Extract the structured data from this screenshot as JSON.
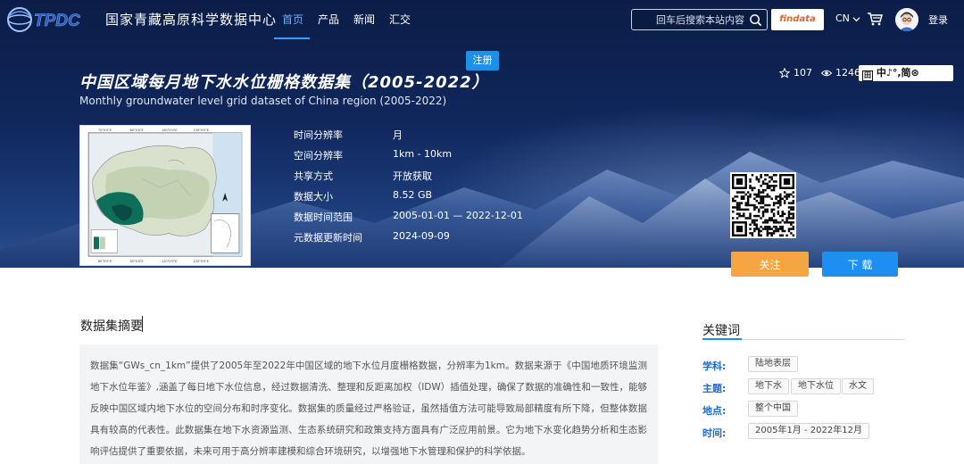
{
  "nav": {
    "site_name": "国家青藏高原科学数据中心",
    "items": [
      {
        "label": "首页",
        "active": true
      },
      {
        "label": "产品",
        "active": false
      },
      {
        "label": "新闻",
        "active": false
      },
      {
        "label": "汇交",
        "active": false
      }
    ],
    "search_placeholder": "回车后搜索本站内容",
    "findata_label": "findata",
    "lang_label": "CN",
    "login_label": "登录"
  },
  "dataset": {
    "register_label": "注册",
    "title_cn": "中国区域每月地下水水位栅格数据集（2005-2022）",
    "title_en": "Monthly groundwater level grid dataset of China region (2005-2022)",
    "stars": "107",
    "views": "1246",
    "toolbar_text": "中♪°,简⊛"
  },
  "meta": [
    {
      "label": "时间分辨率",
      "value": "月"
    },
    {
      "label": "空间分辨率",
      "value": "1km - 10km"
    },
    {
      "label": "共享方式",
      "value": "开放获取"
    },
    {
      "label": "数据大小",
      "value": "8.52 GB"
    },
    {
      "label": "数据时间范围",
      "value": "2005-01-01 — 2022-12-01"
    },
    {
      "label": "元数据更新时间",
      "value": "2024-09-09"
    }
  ],
  "actions": {
    "follow_label": "关注",
    "download_label": "下 载"
  },
  "abstract": {
    "title": "数据集摘要",
    "text": "数据集“GWs_cn_1km”提供了2005年至2022年中国区域的地下水位月度栅格数据，分辨率为1km。数据来源于《中国地质环境监测地下水位年鉴》,涵盖了每日地下水位信息，经过数据清洗、整理和反距离加权（IDW）插值处理，确保了数据的准确性和一致性，能够反映中国区域内地下水位的空间分布和时序变化。数据集的质量经过严格验证，虽然插值方法可能导致局部精度有所下降，但整体数据具有较高的代表性。此数据集在地下水资源监测、生态系统研究和政策支持方面具有广泛应用前景。它为地下水变化趋势分析和生态影响评估提供了重要依据，未来可用于高分辨率建模和综合环境研究，以增强地下水管理和保护的科学依据。"
  },
  "keywords": {
    "title": "关键词",
    "rows": [
      {
        "label": "学科:",
        "tags": [
          "陆地表层"
        ]
      },
      {
        "label": "主题:",
        "tags": [
          "地下水",
          "地下水位",
          "水文"
        ]
      },
      {
        "label": "地点:",
        "tags": [
          "整个中国"
        ]
      },
      {
        "label": "时间:",
        "tags": [
          "2005年1月 - 2022年12月"
        ]
      }
    ]
  },
  "colors": {
    "accent": "#1e8ef0",
    "follow": "#f5a542",
    "nav_active": "#5fb4ff"
  }
}
